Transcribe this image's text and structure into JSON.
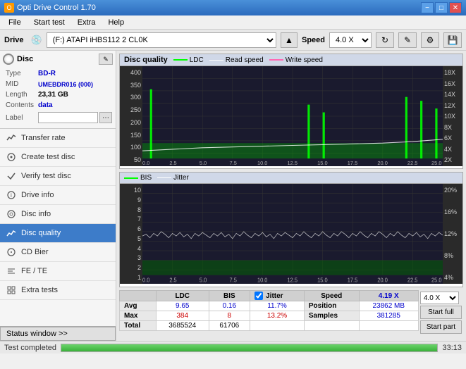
{
  "titleBar": {
    "title": "Opti Drive Control 1.70",
    "minBtn": "−",
    "maxBtn": "□",
    "closeBtn": "✕"
  },
  "menu": {
    "items": [
      "File",
      "Start test",
      "Extra",
      "Help"
    ]
  },
  "driveBar": {
    "label": "Drive",
    "driveValue": "(F:) ATAPI iHBS112  2 CL0K",
    "speedLabel": "Speed",
    "speedValue": "4.0 X"
  },
  "disc": {
    "title": "Disc",
    "type": {
      "label": "Type",
      "value": "BD-R"
    },
    "mid": {
      "label": "MID",
      "value": "UMEBDR016 (000)"
    },
    "length": {
      "label": "Length",
      "value": "23,31 GB"
    },
    "contents": {
      "label": "Contents",
      "value": "data"
    },
    "labelField": {
      "label": "Label",
      "value": ""
    }
  },
  "nav": {
    "items": [
      {
        "id": "transfer-rate",
        "label": "Transfer rate",
        "icon": "chart"
      },
      {
        "id": "create-test-disc",
        "label": "Create test disc",
        "icon": "disc"
      },
      {
        "id": "verify-test-disc",
        "label": "Verify test disc",
        "icon": "check"
      },
      {
        "id": "drive-info",
        "label": "Drive info",
        "icon": "info"
      },
      {
        "id": "disc-info",
        "label": "Disc info",
        "icon": "disc-info"
      },
      {
        "id": "disc-quality",
        "label": "Disc quality",
        "icon": "quality",
        "active": true
      },
      {
        "id": "cd-bier",
        "label": "CD Bier",
        "icon": "cd"
      },
      {
        "id": "fe-te",
        "label": "FE / TE",
        "icon": "fe"
      },
      {
        "id": "extra-tests",
        "label": "Extra tests",
        "icon": "extra"
      }
    ],
    "statusBtn": "Status window >>"
  },
  "charts": {
    "top": {
      "title": "Disc quality",
      "legends": [
        {
          "label": "LDC",
          "color": "#00ff00"
        },
        {
          "label": "Read speed",
          "color": "#ffffff"
        },
        {
          "label": "Write speed",
          "color": "#ff69b4"
        }
      ],
      "yAxisLeft": [
        "400",
        "350",
        "300",
        "250",
        "200",
        "150",
        "100",
        "50"
      ],
      "yAxisRight": [
        "18X",
        "16X",
        "14X",
        "12X",
        "10X",
        "8X",
        "6X",
        "4X",
        "2X"
      ],
      "xLabels": [
        "0.0",
        "2.5",
        "5.0",
        "7.5",
        "10.0",
        "12.5",
        "15.0",
        "17.5",
        "20.0",
        "22.5",
        "25.0 GB"
      ]
    },
    "bottom": {
      "legends": [
        {
          "label": "BIS",
          "color": "#00ff00"
        },
        {
          "label": "Jitter",
          "color": "#ffffff"
        }
      ],
      "yAxisLeft": [
        "10",
        "9",
        "8",
        "7",
        "6",
        "5",
        "4",
        "3",
        "2",
        "1"
      ],
      "yAxisRight": [
        "20%",
        "16%",
        "12%",
        "8%",
        "4%"
      ],
      "xLabels": [
        "0.0",
        "2.5",
        "5.0",
        "7.5",
        "10.0",
        "12.5",
        "15.0",
        "17.5",
        "20.0",
        "22.5",
        "25.0 GB"
      ]
    }
  },
  "stats": {
    "columns": [
      "LDC",
      "BIS"
    ],
    "jitter": {
      "label": "Jitter",
      "checked": true
    },
    "speedLabel": "Speed",
    "speedValue": "4.19 X",
    "speedCombo": "4.0 X",
    "rows": [
      {
        "label": "Avg",
        "ldc": "9.65",
        "bis": "0.16",
        "jitter": "11.7%"
      },
      {
        "label": "Max",
        "ldc": "384",
        "bis": "8",
        "jitter": "13.2%"
      },
      {
        "label": "Total",
        "ldc": "3685524",
        "bis": "61706",
        "jitter": ""
      }
    ],
    "position": {
      "label": "Position",
      "value": "23862 MB"
    },
    "samples": {
      "label": "Samples",
      "value": "381285"
    },
    "buttons": {
      "startFull": "Start full",
      "startPart": "Start part"
    }
  },
  "bottomBar": {
    "statusText": "Test completed",
    "progress": 100,
    "time": "33:13"
  }
}
